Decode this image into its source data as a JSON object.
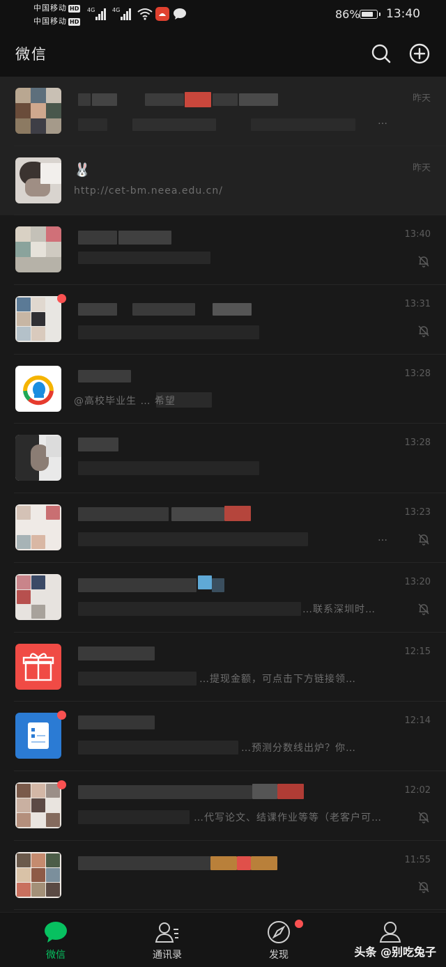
{
  "status_bar": {
    "carrier_1": "中国移动",
    "carrier_2": "中国移动",
    "hd_label": "HD",
    "network_1": "4G",
    "network_2": "4G",
    "battery_percent": "86%",
    "battery_level": 0.86,
    "time": "13:40"
  },
  "header": {
    "title": "微信",
    "search_icon": "search-icon",
    "add_icon": "plus-circle-icon"
  },
  "chats": [
    {
      "name": "",
      "preview": "…",
      "time": "昨天",
      "muted": false,
      "pinned": true,
      "unread_dot": false,
      "avatar": "group-photo-collage"
    },
    {
      "name": "🐰",
      "preview": "http://cet-bm.neea.edu.cn/",
      "time": "昨天",
      "muted": false,
      "pinned": true,
      "unread_dot": false,
      "avatar": "person-photo"
    },
    {
      "name": "",
      "preview": "",
      "time": "13:40",
      "muted": true,
      "pinned": false,
      "unread_dot": false,
      "avatar": "pixelated-photo"
    },
    {
      "name": "",
      "preview": "",
      "time": "13:31",
      "muted": true,
      "pinned": false,
      "unread_dot": true,
      "avatar": "group-photo-collage"
    },
    {
      "name": "",
      "preview": "@高校毕业生 … 希望",
      "time": "13:28",
      "muted": false,
      "pinned": false,
      "unread_dot": false,
      "avatar": "qq-penguin-logo"
    },
    {
      "name": "",
      "preview": "",
      "time": "13:28",
      "muted": false,
      "pinned": false,
      "unread_dot": false,
      "avatar": "person-photo"
    },
    {
      "name": "",
      "preview": "…",
      "time": "13:23",
      "muted": true,
      "pinned": false,
      "unread_dot": false,
      "avatar": "group-photo-collage"
    },
    {
      "name": "",
      "preview": "…联系深圳时…",
      "time": "13:20",
      "muted": true,
      "pinned": false,
      "unread_dot": false,
      "avatar": "group-photo-collage"
    },
    {
      "name": "",
      "preview": "…提现金额，可点击下方链接领…",
      "time": "12:15",
      "muted": false,
      "pinned": false,
      "unread_dot": false,
      "avatar": "red-gift-icon"
    },
    {
      "name": "",
      "preview": "…预测分数线出炉？你…",
      "time": "12:14",
      "muted": false,
      "pinned": false,
      "unread_dot": true,
      "avatar": "blue-document-icon"
    },
    {
      "name": "",
      "preview": "…代写论文、结课作业等等（老客户可…",
      "time": "12:02",
      "muted": true,
      "pinned": false,
      "unread_dot": true,
      "avatar": "group-photo-collage"
    },
    {
      "name": "",
      "preview": "",
      "time": "11:55",
      "muted": true,
      "pinned": false,
      "unread_dot": false,
      "avatar": "group-photo-collage"
    }
  ],
  "tabs": [
    {
      "label": "微信",
      "icon": "chat-bubble-icon",
      "active": true,
      "dot": false
    },
    {
      "label": "通讯录",
      "icon": "contacts-icon",
      "active": false,
      "dot": false
    },
    {
      "label": "发现",
      "icon": "compass-icon",
      "active": false,
      "dot": true
    },
    {
      "label": "我",
      "icon": "person-icon",
      "active": false,
      "dot": false
    }
  ],
  "watermark": "头条 @别吃兔子",
  "colors": {
    "accent": "#07c160",
    "badge": "#fa5151",
    "background": "#191919",
    "pinned_background": "#222222"
  }
}
